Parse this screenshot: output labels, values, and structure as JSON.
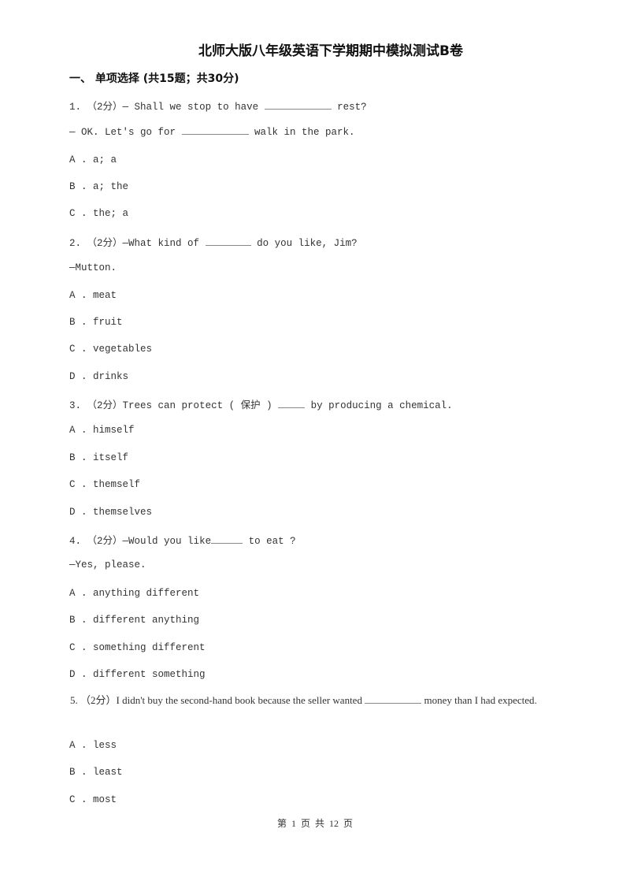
{
  "document": {
    "title": "北师大版八年级英语下学期期中模拟测试B卷",
    "section_heading": "一、  单项选择 (共15题；共30分)"
  },
  "questions": [
    {
      "number": "1.",
      "points": "（2分）",
      "stem_before": "— Shall we stop to have ",
      "stem_after": " rest?",
      "line2_before": "— OK. Let's go for ",
      "line2_after": " walk in the park.",
      "options": [
        {
          "letter": "A .",
          "text": "a; a"
        },
        {
          "letter": "B .",
          "text": "a; the"
        },
        {
          "letter": "C .",
          "text": "the; a"
        }
      ]
    },
    {
      "number": "2.",
      "points": "（2分）",
      "stem_before": "—What kind of ",
      "stem_after": " do you like, Jim?",
      "line2": "—Mutton.",
      "options": [
        {
          "letter": "A .",
          "text": "meat"
        },
        {
          "letter": "B .",
          "text": "fruit"
        },
        {
          "letter": "C .",
          "text": "vegetables"
        },
        {
          "letter": "D .",
          "text": "drinks"
        }
      ]
    },
    {
      "number": "3.",
      "points": "（2分）",
      "stem_before": "Trees can protect ( 保护 ) ",
      "stem_after": " by producing a chemical.",
      "options": [
        {
          "letter": "A .",
          "text": "himself"
        },
        {
          "letter": "B .",
          "text": "itself"
        },
        {
          "letter": "C .",
          "text": "themself"
        },
        {
          "letter": "D .",
          "text": "themselves"
        }
      ]
    },
    {
      "number": "4.",
      "points": "（2分）",
      "stem_before": "—Would you like",
      "stem_after": " to eat ?",
      "line2": "—Yes, please.",
      "options": [
        {
          "letter": "A .",
          "text": "anything different"
        },
        {
          "letter": "B .",
          "text": "different anything"
        },
        {
          "letter": "C .",
          "text": "something different"
        },
        {
          "letter": "D .",
          "text": "different something"
        }
      ]
    },
    {
      "number": "5.",
      "points": "（2分）",
      "stem_before": "I didn't buy the second-hand book because the seller wanted ",
      "stem_after": " money than I had expected.",
      "options": [
        {
          "letter": "A .",
          "text": "less"
        },
        {
          "letter": "B .",
          "text": "least"
        },
        {
          "letter": "C .",
          "text": "most"
        }
      ]
    }
  ],
  "footer": {
    "page_label": "第 1 页 共 12 页"
  }
}
